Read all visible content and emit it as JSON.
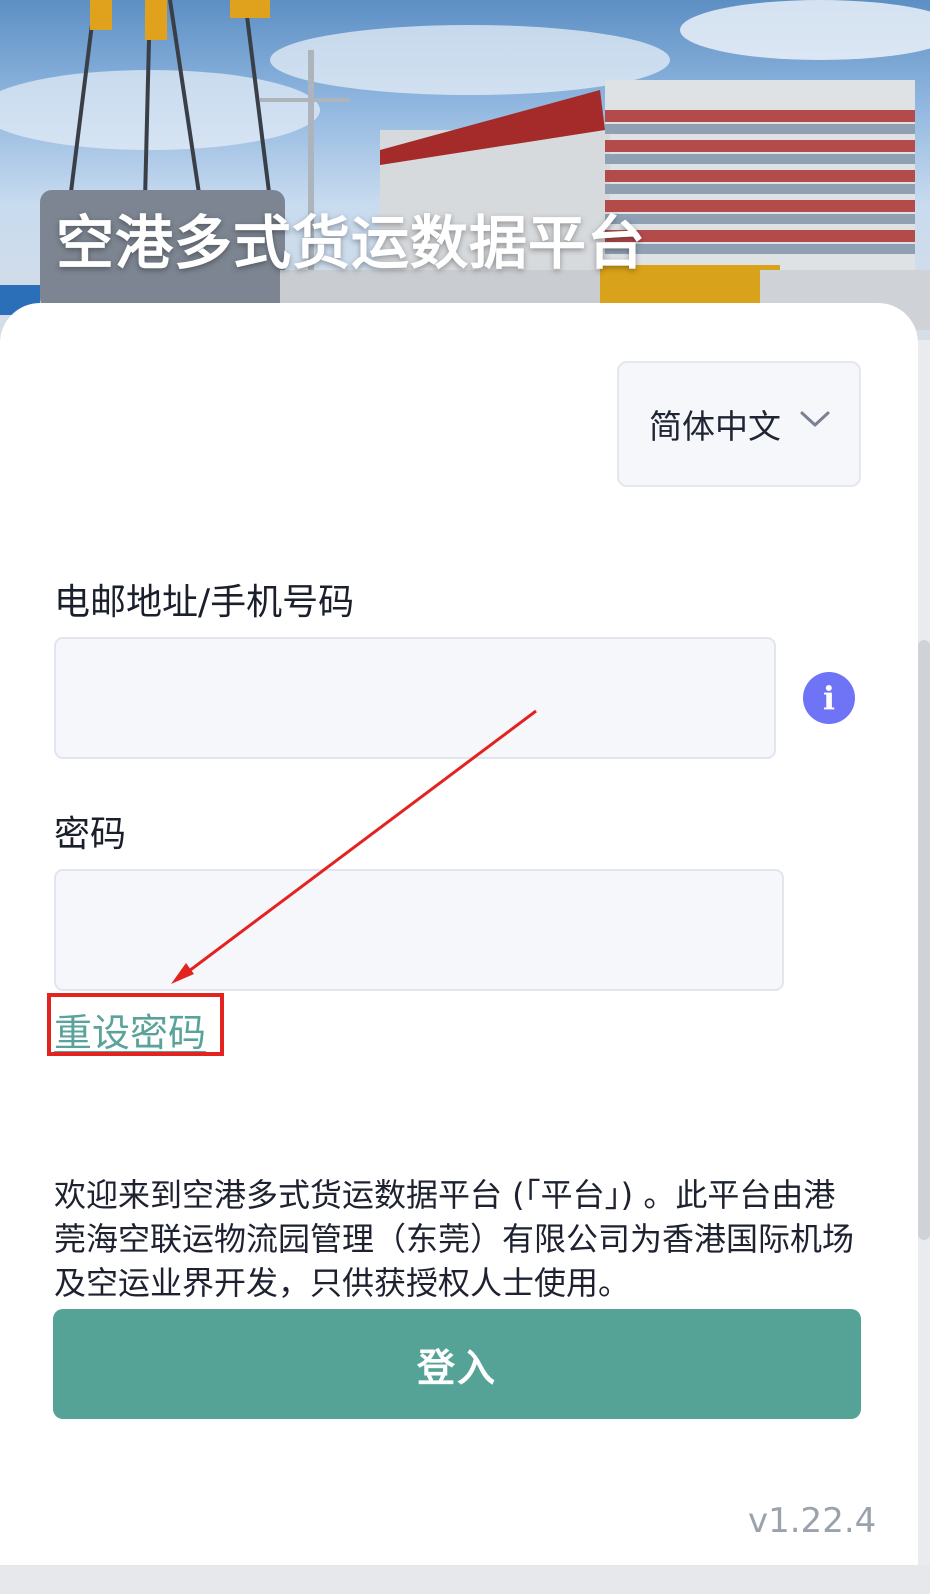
{
  "hero": {
    "title": "空港多式货运数据平台"
  },
  "language_selector": {
    "selected": "简体中文"
  },
  "form": {
    "email_label": "电邮地址/手机号码",
    "email_value": "",
    "email_placeholder": "",
    "password_label": "密码",
    "password_value": "",
    "password_placeholder": "",
    "reset_password_link": "重设密码",
    "info_glyph": "i"
  },
  "disclaimer": "欢迎来到空港多式货运数据平台 (「平台」) 。此平台由港莞海空联运物流园管理（东莞）有限公司为香港国际机场及空运业界开发，只供获授权人士使用。",
  "login_button": "登入",
  "version": "v1.22.4",
  "colors": {
    "primary": "#55a396",
    "link": "#5aa39a",
    "info": "#6f74f6",
    "annotation": "#e3231f",
    "input_bg": "#f6f7fb"
  },
  "icons": [
    "chevron-down-icon",
    "info-icon",
    "annotation-arrow"
  ]
}
